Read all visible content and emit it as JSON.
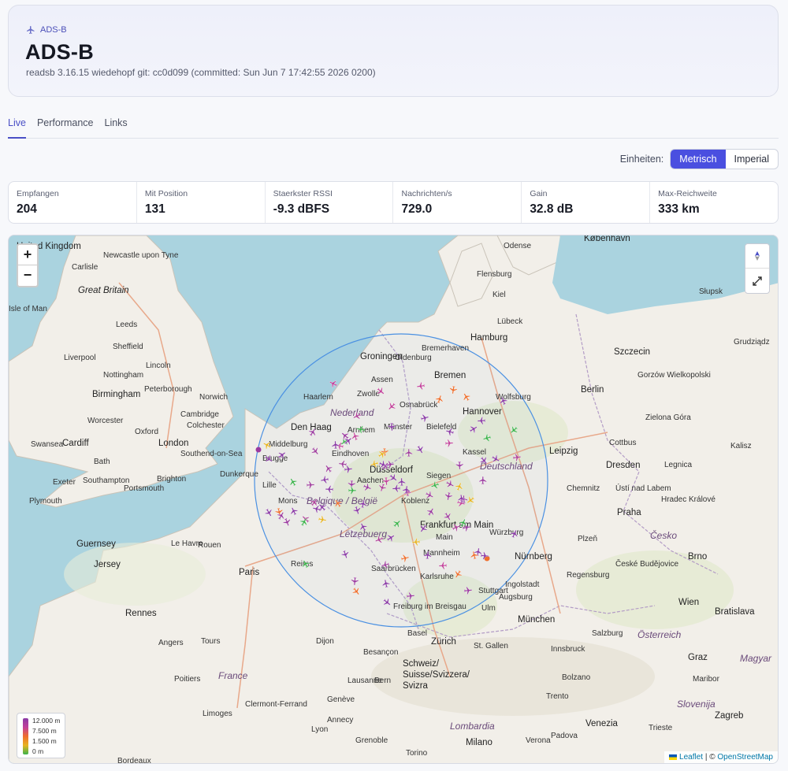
{
  "header": {
    "brand": "ADS-B",
    "title": "ADS-B",
    "subtitle": "readsb 3.16.15 wiedehopf git: cc0d099 (committed: Sun Jun 7 17:42:55 2026 0200)"
  },
  "tabs": [
    {
      "label": "Live",
      "active": true
    },
    {
      "label": "Performance",
      "active": false
    },
    {
      "label": "Links",
      "active": false
    }
  ],
  "units": {
    "label": "Einheiten:",
    "options": [
      {
        "label": "Metrisch",
        "selected": true
      },
      {
        "label": "Imperial",
        "selected": false
      }
    ]
  },
  "stats": [
    {
      "label": "Empfangen",
      "value": "204"
    },
    {
      "label": "Mit Position",
      "value": "131"
    },
    {
      "label": "Staerkster RSSI",
      "value": "-9.3 dBFS"
    },
    {
      "label": "Nachrichten/s",
      "value": "729.0"
    },
    {
      "label": "Gain",
      "value": "32.8 dB"
    },
    {
      "label": "Max-Reichweite",
      "value": "333 km"
    }
  ],
  "map": {
    "zoom_in": "+",
    "zoom_out": "−",
    "legend": [
      "12.000 m",
      "7.500 m",
      "1.500 m",
      "0 m"
    ],
    "attribution": {
      "leaflet": "Leaflet",
      "sep": "|",
      "copy": "©",
      "osm": "OpenStreetMap"
    },
    "colors": {
      "water": "#aad3df",
      "land": "#f2efe9",
      "range_ring": "#4a90e2",
      "high": "#8a3aa6",
      "mid": "#ef6e2c",
      "low": "#3bb34a"
    },
    "labels": {
      "uk": "United Kingdom",
      "gb": "Great Britain",
      "ireland_sea": "Isle of Man",
      "newcastle": "Newcastle upon Tyne",
      "carlisle": "Carlisle",
      "leeds": "Leeds",
      "sheffield": "Sheffield",
      "liverpool": "Liverpool",
      "nottingham": "Nottingham",
      "lincoln": "Lincoln",
      "birmingham": "Birmingham",
      "peterborough": "Peterborough",
      "norwich": "Norwich",
      "cambridge": "Cambridge",
      "colchester": "Colchester",
      "worcester": "Worcester",
      "oxford": "Oxford",
      "cardiff": "Cardiff",
      "swansea": "Swansea",
      "london": "London",
      "southend": "Southend-on-Sea",
      "bath": "Bath",
      "southampton": "Southampton",
      "brighton": "Brighton",
      "portsmouth": "Portsmouth",
      "exeter": "Exeter",
      "plymouth": "Plymouth",
      "guernsey": "Guernsey",
      "jersey": "Jersey",
      "lehavre": "Le Havre",
      "rouen": "Rouen",
      "paris": "Paris",
      "reims": "Reims",
      "rennes": "Rennes",
      "angers": "Angers",
      "tours": "Tours",
      "poitiers": "Poitiers",
      "dijon": "Dijon",
      "limoges": "Limoges",
      "clermont": "Clermont-Ferrand",
      "lyon": "Lyon",
      "bordeaux": "Bordeaux",
      "france": "France",
      "besancon": "Besançon",
      "lille": "Lille",
      "mons": "Mons",
      "brugge": "Brugge",
      "dunkerque": "Dunkerque",
      "belgique": "Belgique / België",
      "middelburg": "Middelburg",
      "denhaag": "Den Haag",
      "haarlem": "Haarlem",
      "nederland": "Nederland",
      "arnhem": "Arnhem",
      "eindhoven": "Eindhoven",
      "zwolle": "Zwolle",
      "groningen": "Groningen",
      "assen": "Assen",
      "aachen": "Aachen",
      "dusseldorf": "Düsseldorf",
      "munster": "Münster",
      "osnabruck": "Osnabrück",
      "bielefeld": "Bielefeld",
      "siegen": "Siegen",
      "koblenz": "Koblenz",
      "letzebuerg": "Lëtzebuerg",
      "frankfurt": "Frankfurt am Main",
      "mainz": "Main",
      "mannheim": "Mannheim",
      "saarbrucken": "Saarbrücken",
      "karlsruhe": "Karlsruhe",
      "freiburg": "Freiburg im Breisgau",
      "stuttgart": "Stuttgart",
      "basel": "Basel",
      "zurich": "Zürich",
      "schweiz": "Schweiz/ Suisse/Svizzera/ Svizra",
      "bern": "Bern",
      "lausanne": "Lausanne",
      "geneve": "Genève",
      "oldenburg": "Oldenburg",
      "bremen": "Bremen",
      "bremerhaven": "Bremerhaven",
      "hamburg": "Hamburg",
      "hannover": "Hannover",
      "wolfsburg": "Wolfsburg",
      "kassel": "Kassel",
      "deutschland": "Deutschland",
      "berlin": "Berlin",
      "leipzig": "Leipzig",
      "dresden": "Dresden",
      "chemnitz": "Chemnitz",
      "wurzburg": "Würzburg",
      "nurnberg": "Nürnberg",
      "ingolstadt": "Ingolstadt",
      "augsburg": "Augsburg",
      "munchen": "München",
      "ulm": "Ulm",
      "regensburg": "Regensburg",
      "praha": "Praha",
      "cesko": "Česko",
      "brno": "Brno",
      "wien": "Wien",
      "bratislava": "Bratislava",
      "osterreich": "Österreich",
      "salzburg": "Salzburg",
      "kobenhavn": "København",
      "odense": "Odense",
      "flensburg": "Flensburg",
      "kiel": "Kiel",
      "lubeck": "Lübeck",
      "slupsk": "Słupsk",
      "szczecin": "Szczecin",
      "gorzow": "Gorzów Wielkopolski",
      "zielona": "Zielona Góra",
      "cottbus": "Cottbus",
      "legnica": "Legnica",
      "usti": "Ústí nad Labem",
      "hradec": "Hradec Králové",
      "plzen": "Plzeň",
      "ceske": "České Budějovice",
      "grudziadz": "Grudziądz",
      "kalisz": "Kalisz",
      "graz": "Graz",
      "maribor": "Maribor",
      "slovenija": "Slovenija",
      "zagreb": "Zagreb",
      "magyar": "Magyar",
      "milano": "Milano",
      "torino": "Torino",
      "venezia": "Venezia",
      "verona": "Verona",
      "padova": "Padova",
      "trento": "Trento",
      "bolzano": "Bolzano",
      "innsbruck": "Innsbruck",
      "lombardia": "Lombardia",
      "triglav": "Trieste",
      "annecy": "Annecy",
      "grenoble": "Grenoble",
      "stgallen": "St. Gallen"
    }
  }
}
